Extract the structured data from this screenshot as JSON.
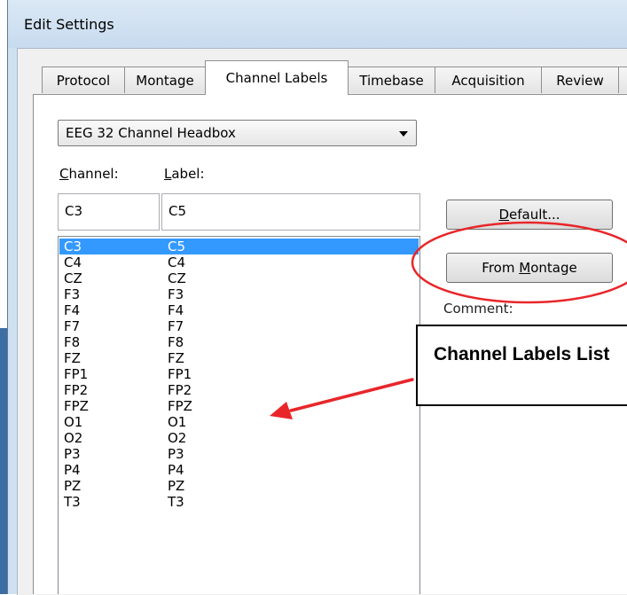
{
  "window": {
    "title": "Edit Settings"
  },
  "tabs": [
    {
      "label": "Protocol",
      "active": false
    },
    {
      "label": "Montage",
      "active": false
    },
    {
      "label": "Channel Labels",
      "active": true
    },
    {
      "label": "Timebase",
      "active": false
    },
    {
      "label": "Acquisition",
      "active": false
    },
    {
      "label": "Review",
      "active": false
    }
  ],
  "headbox": {
    "selected": "EEG 32 Channel Headbox"
  },
  "fields": {
    "channel_label_hotkey": "C",
    "channel_label_rest": "hannel:",
    "label_label_hotkey": "L",
    "label_label_rest": "abel:",
    "channel_value": "C3",
    "label_value": "C5"
  },
  "channel_list": [
    {
      "channel": "C3",
      "label": "C5",
      "selected": true
    },
    {
      "channel": "C4",
      "label": "C4"
    },
    {
      "channel": "CZ",
      "label": "CZ"
    },
    {
      "channel": "F3",
      "label": "F3"
    },
    {
      "channel": "F4",
      "label": "F4"
    },
    {
      "channel": "F7",
      "label": "F7"
    },
    {
      "channel": "F8",
      "label": "F8"
    },
    {
      "channel": "FZ",
      "label": "FZ"
    },
    {
      "channel": "FP1",
      "label": "FP1"
    },
    {
      "channel": "FP2",
      "label": "FP2"
    },
    {
      "channel": "FPZ",
      "label": "FPZ"
    },
    {
      "channel": "O1",
      "label": "O1"
    },
    {
      "channel": "O2",
      "label": "O2"
    },
    {
      "channel": "P3",
      "label": "P3"
    },
    {
      "channel": "P4",
      "label": "P4"
    },
    {
      "channel": "PZ",
      "label": "PZ"
    },
    {
      "channel": "T3",
      "label": "T3"
    }
  ],
  "buttons": {
    "default_hotkey": "D",
    "default_rest": "efault...",
    "from_montage_pre": "From ",
    "from_montage_hotkey": "M",
    "from_montage_rest": "ontage"
  },
  "comment_label": "Comment:",
  "annotation": {
    "callout_text": "Channel Labels List",
    "highlight_color": "#e8262a",
    "selection_color": "#3399ff"
  }
}
